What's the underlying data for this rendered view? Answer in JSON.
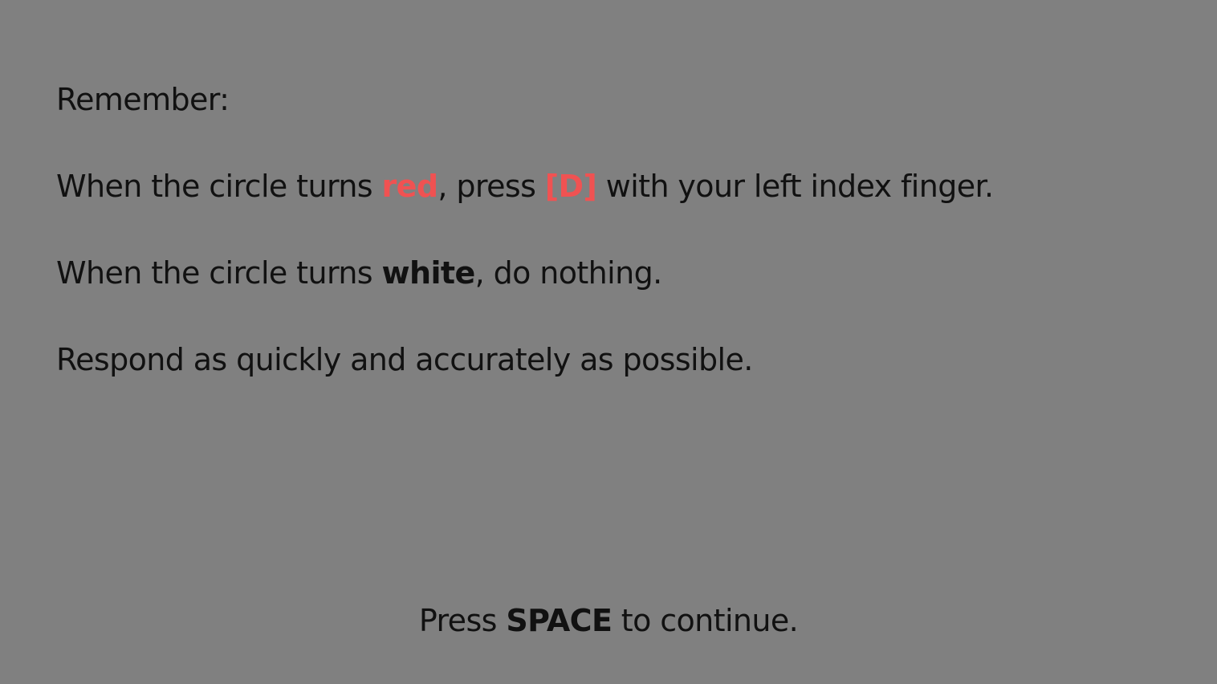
{
  "colors": {
    "background": "#808080",
    "text": "#111111",
    "accent_red": "#f05252"
  },
  "instructions": {
    "heading": "Remember:",
    "red_rule": {
      "prefix": "When the circle turns ",
      "color_word": "red",
      "middle": ", press ",
      "key": "[D]",
      "suffix": " with your left index finger."
    },
    "white_rule": {
      "prefix": "When the circle turns ",
      "color_word": "white",
      "suffix": ", do nothing."
    },
    "speed_note": "Respond as quickly and accurately as possible."
  },
  "footer": {
    "prefix": "Press ",
    "key": "SPACE",
    "suffix": " to continue."
  }
}
